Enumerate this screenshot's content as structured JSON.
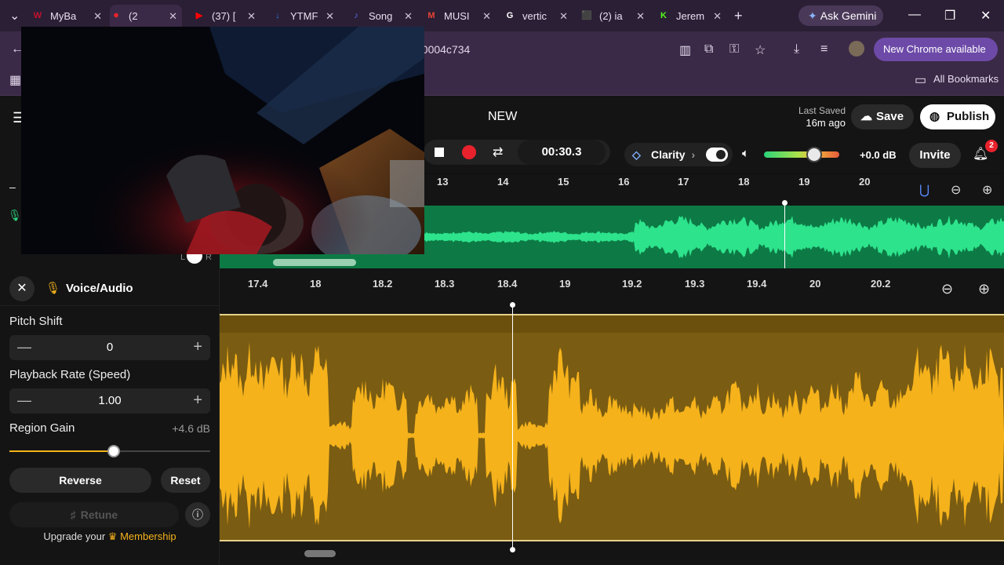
{
  "browser": {
    "tabs": [
      {
        "label": "MyBa",
        "fav": "W",
        "fav_color": "#c8102e"
      },
      {
        "label": "(2",
        "fav": "⏺",
        "fav_color": "#e8222c"
      },
      {
        "label": "(37) [",
        "fav": "▶",
        "fav_color": "#ff0000"
      },
      {
        "label": "YTMF",
        "fav": "↓",
        "fav_color": "#2f7de1"
      },
      {
        "label": "Song",
        "fav": "♪",
        "fav_color": "#5b6cf0"
      },
      {
        "label": "MUSI",
        "fav": "M",
        "fav_color": "#ea4335"
      },
      {
        "label": "vertic",
        "fav": "G",
        "fav_color": "#ffffff"
      },
      {
        "label": "(2) ia",
        "fav": "⬛",
        "fav_color": "#9146ff"
      },
      {
        "label": "Jerem",
        "fav": "K",
        "fav_color": "#53fc18"
      }
    ],
    "ask_gemini": "Ask Gemini",
    "url_fragment": "90004c734",
    "new_chrome": "New Chrome available",
    "all_bookmarks": "All Bookmarks"
  },
  "app": {
    "title": "NEW",
    "last_saved_label": "Last Saved",
    "last_saved_time": "16m ago",
    "save_label": "Save",
    "publish_label": "Publish",
    "timecode": "00:30.3",
    "clarity_label": "Clarity",
    "master_gain": "+0.0 dB",
    "invite_label": "Invite",
    "notification_count": "2"
  },
  "top_ruler": [
    "13",
    "14",
    "15",
    "16",
    "17",
    "18",
    "19",
    "20"
  ],
  "bottom_ruler": [
    "17.4",
    "18",
    "18.2",
    "18.3",
    "18.4",
    "19",
    "19.2",
    "19.3",
    "19.4",
    "20",
    "20.2"
  ],
  "panel": {
    "title": "Voice/Audio",
    "pitch_label": "Pitch Shift",
    "pitch_value": "0",
    "rate_label": "Playback Rate (Speed)",
    "rate_value": "1.00",
    "gain_label": "Region Gain",
    "gain_value": "+4.6 dB",
    "gain_level": 0.52,
    "reverse_label": "Reverse",
    "reset_label": "Reset",
    "retune_label": "Retune",
    "upgrade_prefix": "Upgrade your",
    "membership_label": "Membership",
    "pan_left": "L",
    "pan_right": "R"
  },
  "colors": {
    "track_green": "#0d7a45",
    "wave_green": "#2de38c",
    "region_yellow": "#7a5c12",
    "wave_yellow": "#f5b21b",
    "record_red": "#e8222c"
  }
}
